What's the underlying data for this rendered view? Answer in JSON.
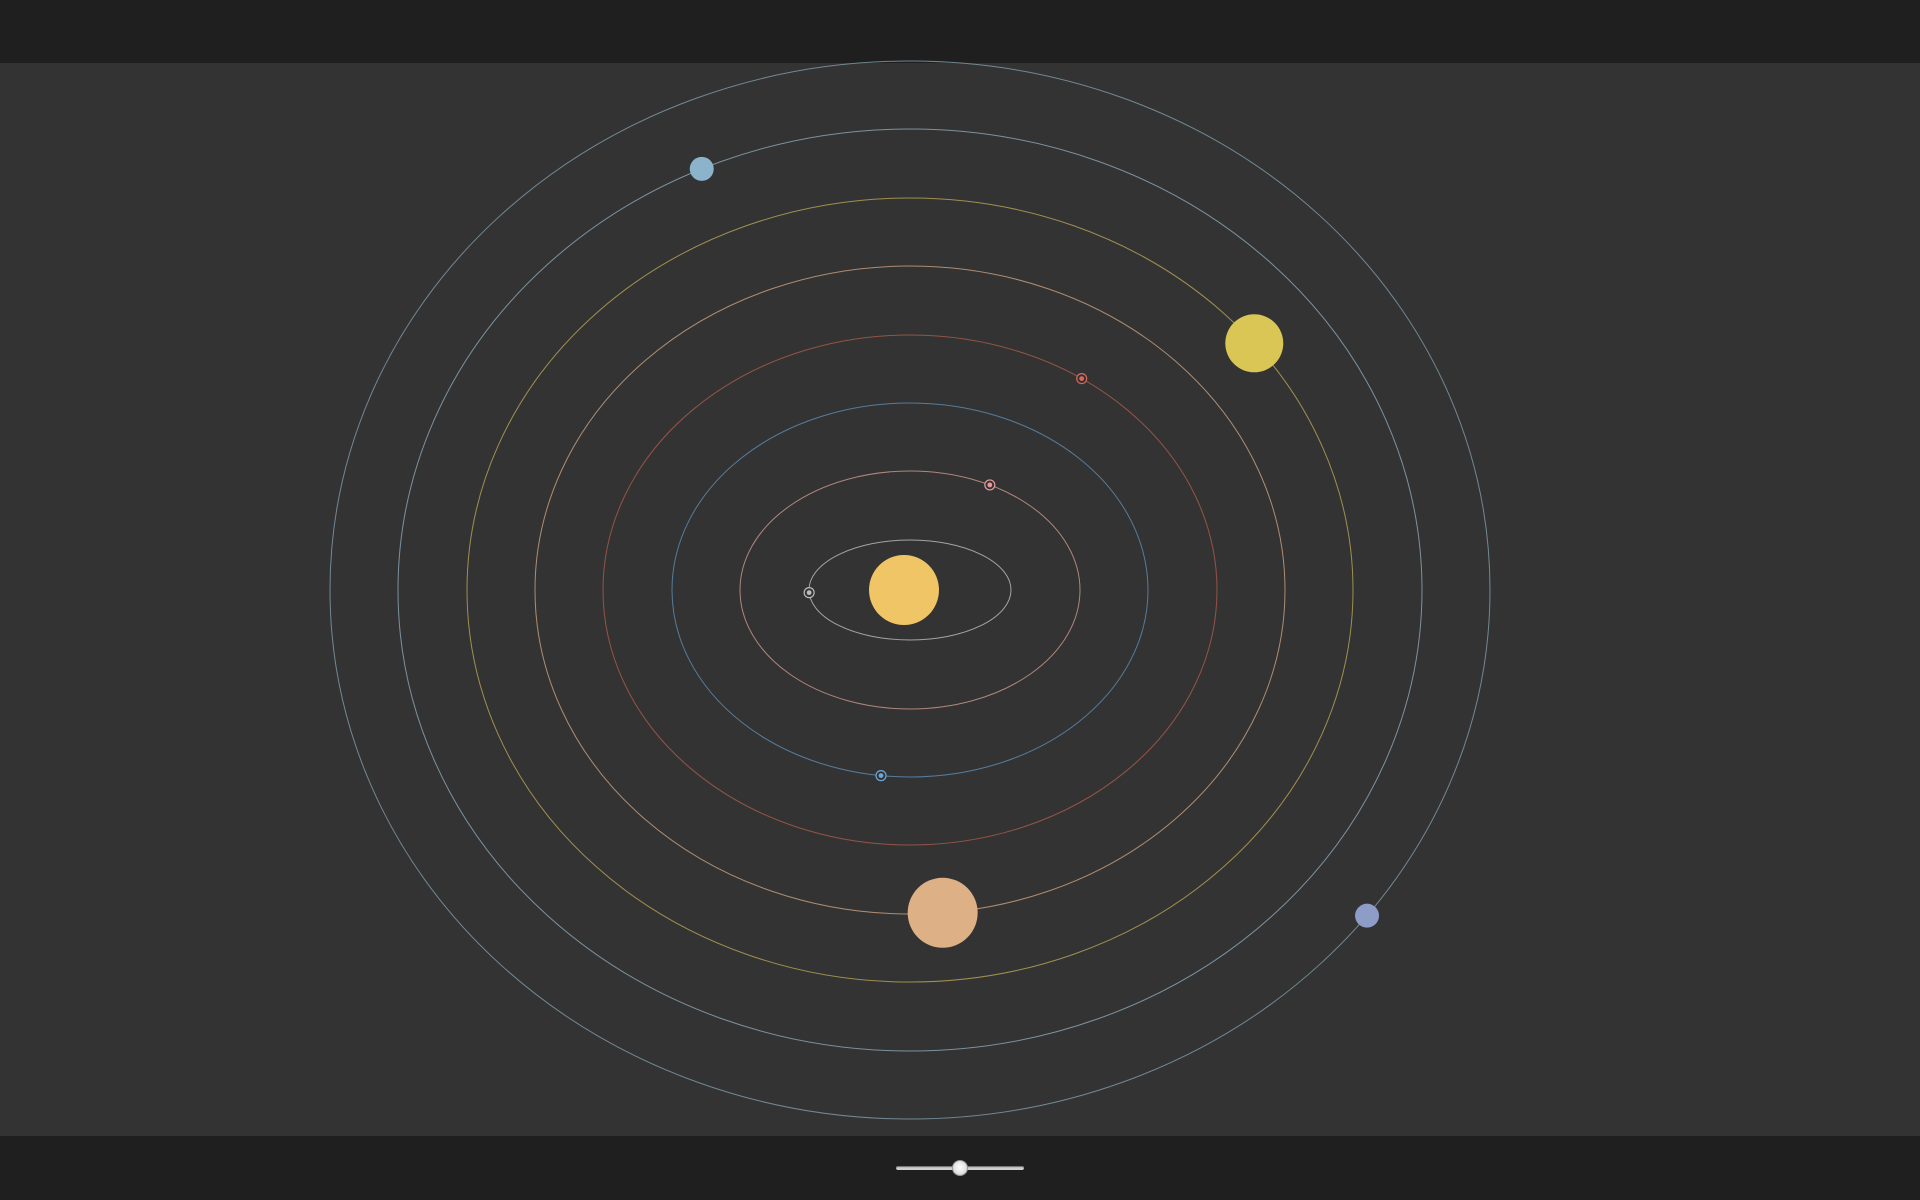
{
  "colors": {
    "toolbar_bg": "#1f1f1f",
    "canvas_bg": "#333333",
    "sun": "#f0c566"
  },
  "sun": {
    "name": "sun",
    "color": "#f0c566"
  },
  "orbits": [
    {
      "name": "mercury",
      "color": "#b8b8b8",
      "planet_color": "#bbbbbb",
      "angle_deg": 183,
      "style": "ring"
    },
    {
      "name": "venus",
      "color": "#c4958a",
      "planet_color": "#e89a9a",
      "angle_deg": 62,
      "style": "ring"
    },
    {
      "name": "earth",
      "color": "#5d89b0",
      "planet_color": "#6ea7d8",
      "angle_deg": 263,
      "style": "ring"
    },
    {
      "name": "mars",
      "color": "#a55a4a",
      "planet_color": "#d86a5a",
      "angle_deg": 56,
      "style": "ring"
    },
    {
      "name": "jupiter",
      "color": "#c49e7e",
      "planet_color": "#deb085",
      "angle_deg": 275,
      "style": "disc"
    },
    {
      "name": "saturn",
      "color": "#b5a055",
      "planet_color": "#d9c655",
      "angle_deg": 39,
      "style": "disc"
    },
    {
      "name": "uranus",
      "color": "#8aa3b3",
      "planet_color": "#8bb4cc",
      "angle_deg": 114,
      "style": "disc"
    },
    {
      "name": "neptune",
      "color": "#7e98a6",
      "planet_color": "#8e9cc8",
      "angle_deg": 322,
      "style": "disc"
    }
  ],
  "speed_slider": {
    "value": 0.5
  }
}
